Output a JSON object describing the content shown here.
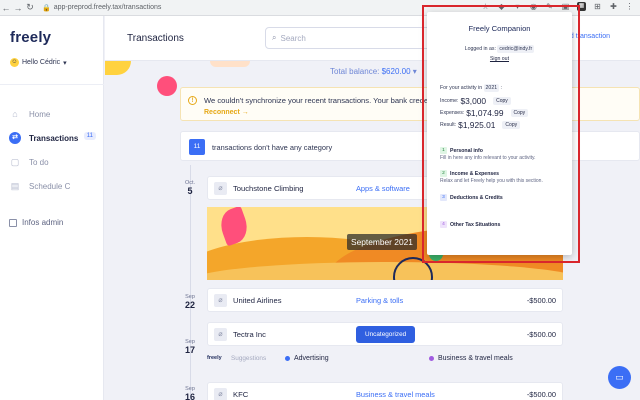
{
  "browser": {
    "url": "app-preprod.freely.tax/transactions"
  },
  "sidebar": {
    "logo": "freely",
    "user": "Hello Cédric",
    "items": [
      {
        "label": "Home",
        "icon": "home-icon"
      },
      {
        "label": "Transactions",
        "icon": "transactions-icon",
        "count": "11"
      },
      {
        "label": "To do",
        "icon": "todo-icon"
      },
      {
        "label": "Schedule C",
        "icon": "schedule-icon"
      }
    ],
    "admin": "Infos admin"
  },
  "header": {
    "title": "Transactions",
    "search_placeholder": "Search",
    "add_transaction": "dd transaction"
  },
  "balance": {
    "label": "Total balance:",
    "value": "$620.00"
  },
  "warning": {
    "message": "We couldn't synchronize your recent transactions. Your bank credentials hav",
    "action": "Reconnect →"
  },
  "uncategorized": {
    "count": "11",
    "text": "transactions don't have any category"
  },
  "month_label": "September 2021",
  "transactions": [
    {
      "month": "Oct.",
      "day": "5",
      "merchant": "Touchstone Climbing",
      "category": "Apps & software",
      "amount": ""
    },
    {
      "month": "Sep",
      "day": "22",
      "merchant": "United Airlines",
      "category": "Parking & tolls",
      "amount": "-$500.00"
    },
    {
      "month": "Sep",
      "day": "17",
      "merchant": "Tectra Inc",
      "category": "Uncategorized",
      "amount": "-$500.00"
    },
    {
      "month": "Sep",
      "day": "16",
      "merchant": "KFC",
      "category": "Business & travel meals",
      "amount": "-$500.00"
    }
  ],
  "suggestions": {
    "logo": "freely",
    "label": "Suggestions",
    "items": [
      {
        "label": "Advertising",
        "color": "#3b6ef5"
      },
      {
        "label": "Business & travel meals",
        "color": "#a05be0"
      }
    ]
  },
  "companion": {
    "title": "Freely Companion",
    "logged_in_label": "Logged in as:",
    "email": "cedric@indy.fr",
    "sign_out": "Sign out",
    "activity_label": "For your activity in",
    "year": "2021",
    "activity_suffix": ":",
    "income_label": "Income:",
    "income": "$3,000",
    "expenses_label": "Expenses:",
    "expenses": "$1,074.99",
    "result_label": "Result:",
    "result": "$1,925.01",
    "copy_label": "Copy",
    "sections": [
      {
        "num": "1",
        "title": "Personal info",
        "desc": "Fill in here any info relevant to your activity.",
        "color": "#dff5e4",
        "text_color": "#2a8a45"
      },
      {
        "num": "2",
        "title": "Income & Expenses",
        "desc": "Relax and let Freely help you with this section.",
        "color": "#dff5e4",
        "text_color": "#2a8a45"
      },
      {
        "num": "3",
        "title": "Deductions & Credits",
        "desc": "",
        "color": "#e3e8fb",
        "text_color": "#3b6ef5"
      },
      {
        "num": "4",
        "title": "Other Tax Situations",
        "desc": "",
        "color": "#efe3fb",
        "text_color": "#a05be0"
      }
    ]
  }
}
